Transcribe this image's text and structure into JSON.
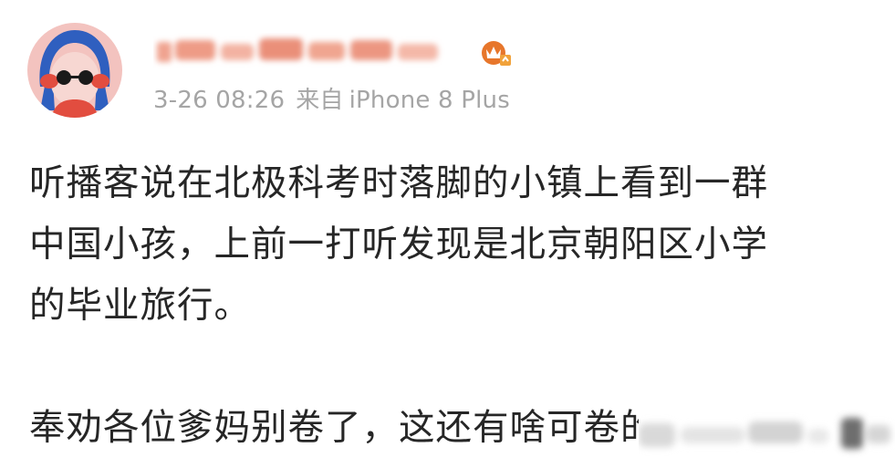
{
  "post": {
    "author": {
      "avatar_icon": "cartoon-girl-avatar-icon",
      "username_display": "redacted (blurred)",
      "badge_icon": "vip-crown-badge-icon"
    },
    "meta": {
      "time": "3-26 08:26",
      "from_label": "来自",
      "device": "iPhone 8 Plus"
    },
    "content": {
      "lines": [
        "听播客说在北极科考时落脚的小镇上看到一群",
        "中国小孩，上前一打听发现是北京朝阳区小学",
        "的毕业旅行。"
      ],
      "lines2": [
        "奉劝各位爹妈别卷了，这还有啥可卷的"
      ]
    },
    "colors": {
      "meta_gray": "#a5a5a5",
      "text": "#262626",
      "avatar_bg": "#f3c3bf",
      "hair_blue": "#2f5fbf",
      "badge_orange": "#e7762b"
    }
  }
}
